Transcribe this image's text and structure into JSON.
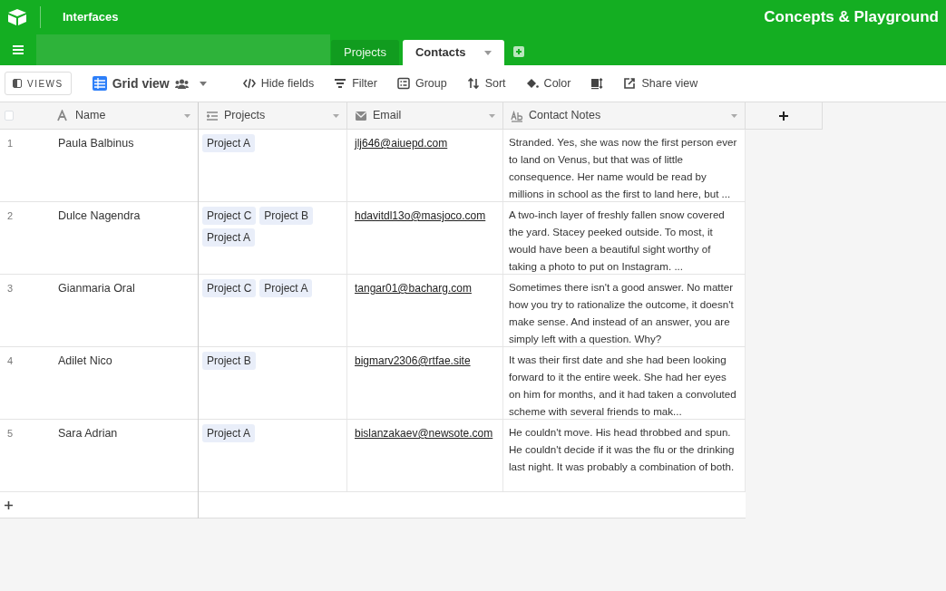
{
  "app": {
    "section": "Interfaces",
    "base_title": "Concepts & Playground"
  },
  "tabs": [
    {
      "label": "Projects",
      "selected": false
    },
    {
      "label": "Contacts",
      "selected": true
    }
  ],
  "toolbar": {
    "views_button": "VIEWS",
    "view_name": "Grid view",
    "items": [
      "Hide fields",
      "Filter",
      "Group",
      "Sort",
      "Color"
    ],
    "share_label": "Share view"
  },
  "table": {
    "select_all_checked": false,
    "columns": [
      "Name",
      "Projects",
      "Email",
      "Contact Notes"
    ],
    "rows": [
      {
        "number": "1",
        "name": "Paula Balbinus",
        "projects": [
          "Project A"
        ],
        "email": "jlj646@aiuepd.com",
        "notes": "Stranded. Yes, she was now the first person ever to land on Venus, but that was of little consequence. Her name would be read by millions in school as the first to land here, but ..."
      },
      {
        "number": "2",
        "name": "Dulce Nagendra",
        "projects": [
          "Project C",
          "Project B",
          "Project A"
        ],
        "email": "hdavitdl13o@masjoco.com",
        "notes": "A two-inch layer of freshly fallen snow covered the yard. Stacey peeked outside. To most, it would have been a beautiful sight worthy of taking a photo to put on Instagram. ..."
      },
      {
        "number": "3",
        "name": "Gianmaria Oral",
        "projects": [
          "Project C",
          "Project A"
        ],
        "email": "tangar01@bacharg.com",
        "notes": "Sometimes there isn't a good answer. No matter how you try to rationalize the outcome, it doesn't make sense. And instead of an answer, you are simply left with a question. Why?"
      },
      {
        "number": "4",
        "name": "Adilet Nico",
        "projects": [
          "Project B"
        ],
        "email": "bigmarv2306@rtfae.site",
        "notes": "It was their first date and she had been looking forward to it the entire week. She had her eyes on him for months, and it had taken a convoluted scheme with several friends to mak..."
      },
      {
        "number": "5",
        "name": "Sara Adrian",
        "projects": [
          "Project A"
        ],
        "email": "bislanzakaev@newsote.com",
        "notes": "He couldn't move. His head throbbed and spun. He couldn't decide if it was the flu or the drinking last night. It was probably a combination of both."
      }
    ]
  }
}
